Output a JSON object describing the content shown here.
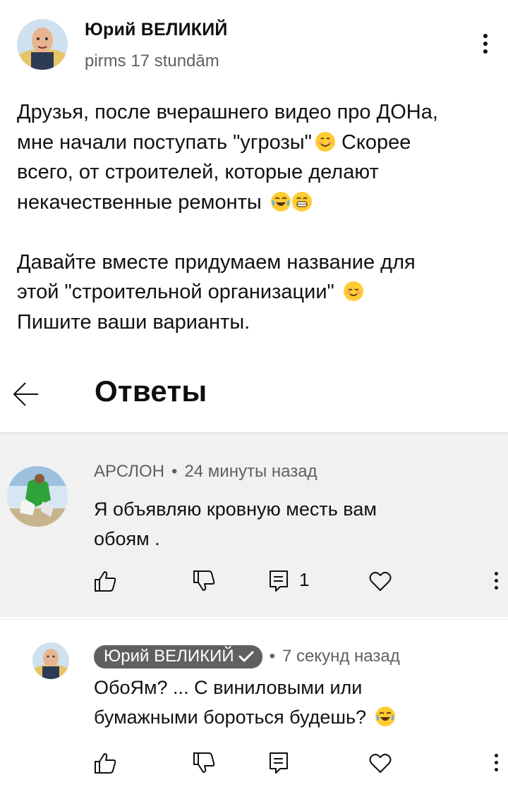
{
  "post": {
    "author": "Юрий ВЕЛИКИЙ",
    "time": "pirms 17 stundām",
    "lines_1": [
      "Друзья, после вчерашнего видео про ДОНа,",
      "мне начали поступать \"угрозы\"",
      " Скорее",
      "всего, от строителей, которые делают",
      "некачественные ремонты"
    ],
    "lines_2": [
      "Давайте вместе придумаем название для",
      "этой \"строительной организации\"",
      "Пишите ваши варианты."
    ]
  },
  "replies": {
    "title": "Ответы"
  },
  "comments": [
    {
      "author": "АРСЛОН",
      "time": "24 минуты назад",
      "text_1": "Я объявляю кровную месть вам",
      "text_2": "обоям .",
      "reply_count": "1"
    },
    {
      "author": "Юрий ВЕЛИКИЙ",
      "time": "7 секунд назад",
      "text_1": "ОбоЯм? ... С виниловыми или",
      "text_2": "бумажными бороться будешь?"
    }
  ],
  "icons": {
    "like": "thumbs-up-icon",
    "dislike": "thumbs-down-icon",
    "reply": "reply-comment-icon",
    "heart": "heart-icon",
    "more": "more-vertical-icon",
    "back": "arrow-left-icon"
  },
  "colors": {
    "text": "#0f0f0f",
    "secondary": "#606060",
    "highlight_bg": "#f1f1f1",
    "chip_bg": "#606060"
  }
}
